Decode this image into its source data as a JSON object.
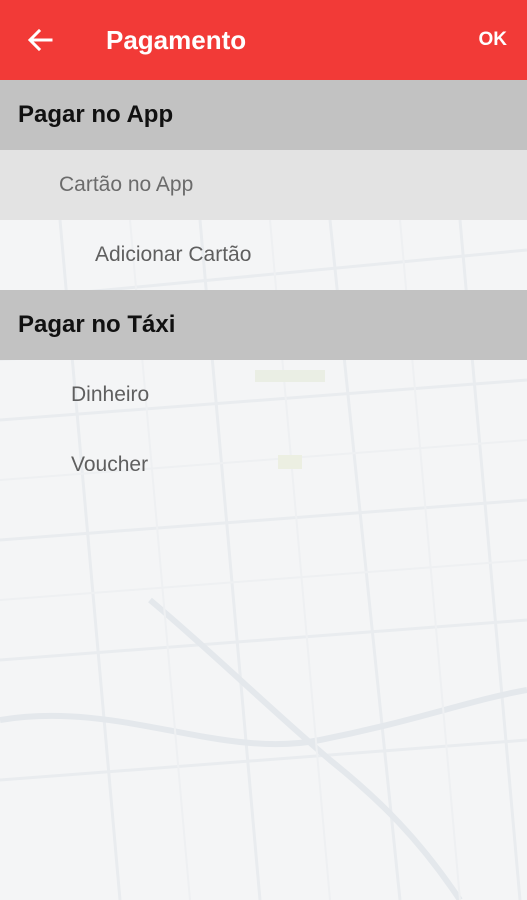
{
  "appbar": {
    "title": "Pagamento",
    "back_icon": "arrow-left-icon",
    "ok_label": "OK",
    "background_color": "#f23a37"
  },
  "sections": [
    {
      "header": "Pagar no App",
      "groups": [
        {
          "label": "Cartão no App",
          "items": [
            {
              "label": "Adicionar Cartão"
            }
          ]
        }
      ]
    },
    {
      "header": "Pagar no Táxi",
      "items": [
        {
          "label": "Dinheiro"
        },
        {
          "label": "Voucher"
        }
      ]
    }
  ]
}
